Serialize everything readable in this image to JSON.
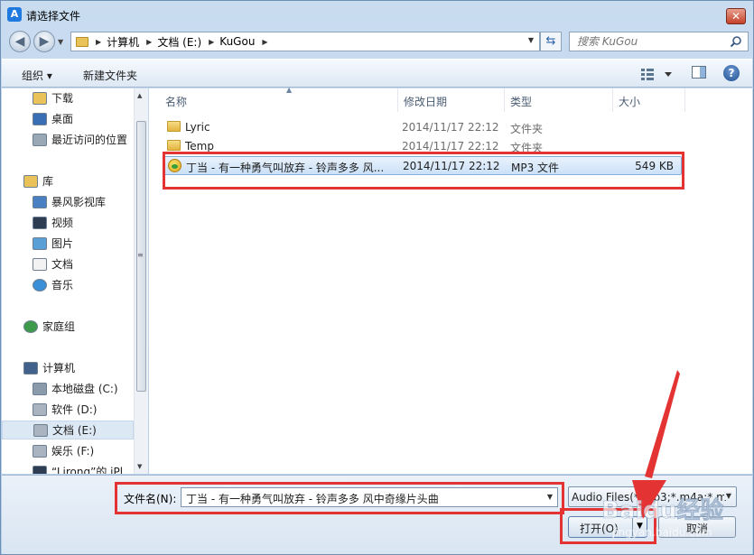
{
  "window": {
    "title": "请选择文件",
    "app_icon_letter": "A",
    "close_label": "✕"
  },
  "address": {
    "segments": [
      "计算机",
      "文档 (E:)",
      "KuGou"
    ],
    "search_placeholder": "搜索 KuGou"
  },
  "toolbar": {
    "organize_label": "组织 ▾",
    "new_folder_label": "新建文件夹",
    "help_label": "?"
  },
  "nav": {
    "items": [
      {
        "label": "下载",
        "icon": "download-folder-icon",
        "indent": 1
      },
      {
        "label": "桌面",
        "icon": "desktop-icon",
        "indent": 1
      },
      {
        "label": "最近访问的位置",
        "icon": "recent-places-icon",
        "indent": 1
      },
      {
        "label": "库",
        "icon": "library-icon",
        "indent": 0
      },
      {
        "label": "暴风影视库",
        "icon": "video-library-icon",
        "indent": 1
      },
      {
        "label": "视频",
        "icon": "video-icon",
        "indent": 1
      },
      {
        "label": "图片",
        "icon": "picture-icon",
        "indent": 1
      },
      {
        "label": "文档",
        "icon": "document-icon",
        "indent": 1
      },
      {
        "label": "音乐",
        "icon": "music-icon",
        "indent": 1
      },
      {
        "label": "家庭组",
        "icon": "homegroup-icon",
        "indent": 0
      },
      {
        "label": "计算机",
        "icon": "computer-icon",
        "indent": 0
      },
      {
        "label": "本地磁盘 (C:)",
        "icon": "system-drive-icon",
        "indent": 1
      },
      {
        "label": "软件 (D:)",
        "icon": "drive-icon",
        "indent": 1
      },
      {
        "label": "文档 (E:)",
        "icon": "drive-icon",
        "indent": 1,
        "selected": true
      },
      {
        "label": "娱乐 (F:)",
        "icon": "drive-icon",
        "indent": 1
      },
      {
        "label": "“Lirong”的 iPl",
        "icon": "device-icon",
        "indent": 1
      }
    ]
  },
  "columns": {
    "name": "名称",
    "modified": "修改日期",
    "type": "类型",
    "size": "大小"
  },
  "files": [
    {
      "name": "Lyric",
      "modified": "2014/11/17 22:12",
      "type": "文件夹",
      "size": "",
      "icon": "folder-icon"
    },
    {
      "name": "Temp",
      "modified": "2014/11/17 22:12",
      "type": "文件夹",
      "size": "",
      "icon": "folder-icon"
    },
    {
      "name": "丁当 - 有一种勇气叫放弃 - 铃声多多 风...",
      "modified": "2014/11/17 22:12",
      "type": "MP3 文件",
      "size": "549 KB",
      "icon": "mp3-file-icon",
      "selected": true
    }
  ],
  "footer": {
    "filename_label": "文件名(N):",
    "filename_value": "丁当 - 有一种勇气叫放弃 - 铃声多多 风中奇缘片头曲",
    "filetype_value": "Audio Files(*.mp3;*.m4a;*.m",
    "open_label": "打开(O)",
    "cancel_label": "取消"
  },
  "watermark": {
    "text_top": "Baidu经验",
    "text_bottom": "jingyan.baidu.com"
  },
  "colors": {
    "highlight": "#e33333",
    "accent": "#2c63a8"
  }
}
